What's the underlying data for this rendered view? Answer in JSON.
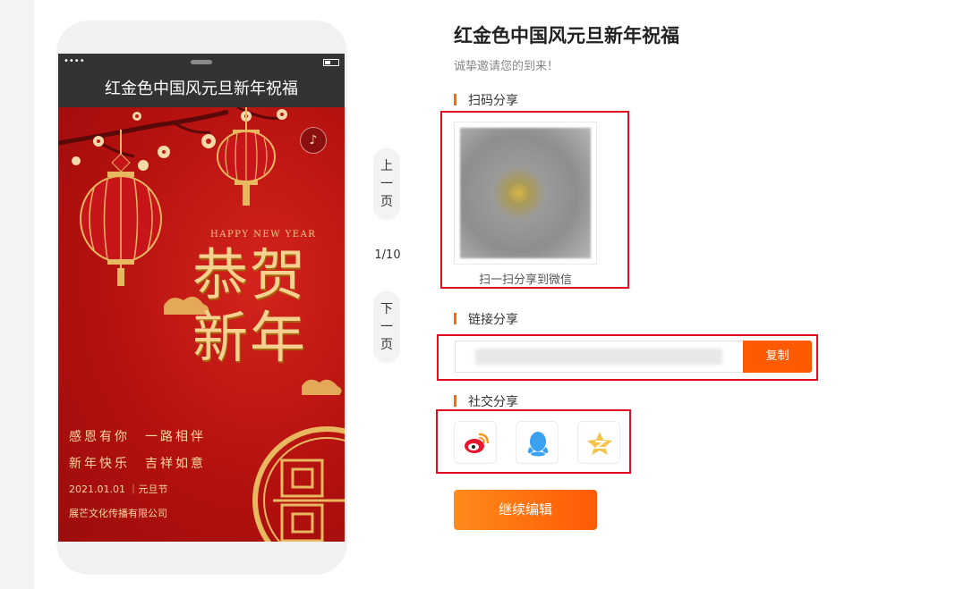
{
  "phone": {
    "status_dots": "••••",
    "title": "红金色中国风元旦新年祝福",
    "poster": {
      "happy_new_year": "HAPPY NEW YEAR",
      "line_big_1": "恭贺",
      "line_big_2": "新年",
      "verse_1": "感恩有你　一路相伴",
      "verse_2": "新年快乐　吉祥如意",
      "date_line": "2021.01.01 ｜元旦节",
      "company": "展芒文化传播有限公司"
    }
  },
  "pager": {
    "prev_label": [
      "上",
      "一",
      "页"
    ],
    "next_label": [
      "下",
      "一",
      "页"
    ],
    "page_indicator": "1/10"
  },
  "panel": {
    "title": "红金色中国风元旦新年祝福",
    "subtitle": "诚挚邀请您的到来！",
    "qr_section_label": "扫码分享",
    "qr_caption": "扫一扫分享到微信",
    "link_section_label": "链接分享",
    "copy_label": "复制",
    "social_section_label": "社交分享",
    "social_icons": [
      "weibo-icon",
      "qq-icon",
      "qzone-icon"
    ],
    "continue_label": "继续编辑"
  },
  "colors": {
    "accent_orange": "#ff5a00",
    "highlight_red": "#e00d1f",
    "poster_red": "#b3110f",
    "poster_gold": "#f5d08e",
    "title_bar_dark": "#333333"
  }
}
